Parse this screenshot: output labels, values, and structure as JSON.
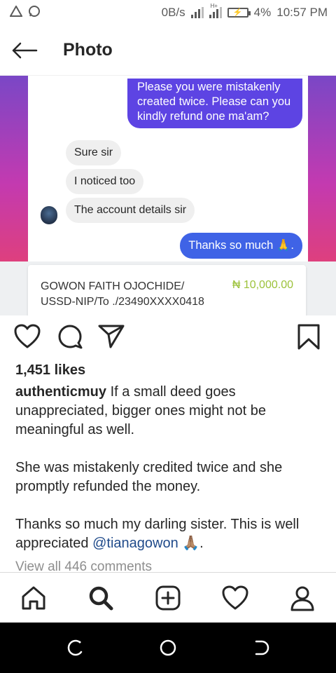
{
  "status_bar": {
    "data_rate": "0B/s",
    "battery": "4%",
    "time": "10:57 PM",
    "network_label": "H+",
    "icons": [
      "alert-triangle-icon",
      "whatsapp-icon",
      "signal-icon",
      "battery-charging-icon"
    ]
  },
  "header": {
    "title": "Photo"
  },
  "photo": {
    "messages": {
      "outgoing_1": "Please you were mistakenly created twice. Please can you kindly refund one ma'am?",
      "incoming": [
        "Sure sir",
        "I noticed too",
        "The account details sir"
      ],
      "outgoing_2": "Thanks so much 🙏."
    },
    "transaction": {
      "name": "GOWON FAITH OJOCHIDE/ USSD-NIP/To ./23490XXXX0418",
      "amount": "₦ 10,000.00"
    },
    "colors": {
      "outgoing_bubble": "#5d44e3",
      "amount": "#9cc23a"
    }
  },
  "post": {
    "likes": "1,451 likes",
    "username": "authenticmuy",
    "caption_1": " If a small deed goes unappreciated, bigger ones might not be meaningful as well.",
    "caption_2": "She was mistakenly credited twice and she promptly refunded the money.",
    "caption_3": "Thanks so much my darling sister. This is well appreciated ",
    "mention": "@tianagowon",
    "caption_end": " 🙏🏽.",
    "view_comments": "View all 446 comments"
  },
  "actions": {
    "icons": [
      "heart-icon",
      "comment-icon",
      "share-icon",
      "bookmark-icon"
    ]
  },
  "bottom_nav": {
    "items": [
      "home-icon",
      "search-icon",
      "add-post-icon",
      "activity-heart-icon",
      "profile-icon"
    ]
  }
}
